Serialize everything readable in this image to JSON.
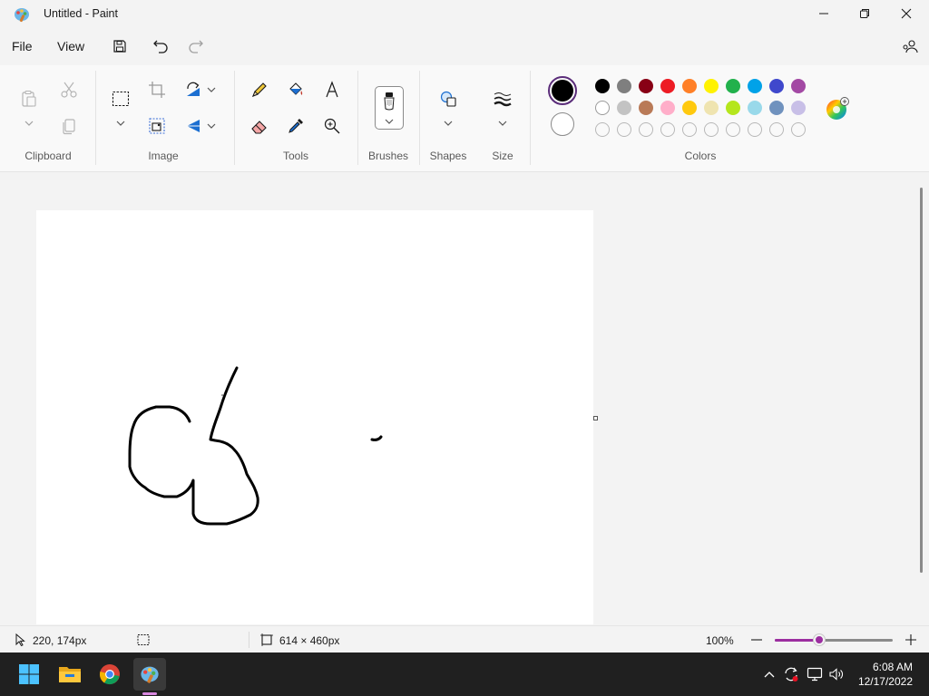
{
  "window": {
    "title": "Untitled - Paint",
    "controls": [
      "minimize-icon",
      "restore-icon",
      "close-icon"
    ]
  },
  "menu": {
    "file": "File",
    "view": "View",
    "icons": [
      "save-icon",
      "undo-icon",
      "redo-icon",
      "share-icon"
    ]
  },
  "ribbon": {
    "groups": {
      "clipboard": "Clipboard",
      "image": "Image",
      "tools": "Tools",
      "brushes": "Brushes",
      "shapes": "Shapes",
      "size": "Size",
      "colors": "Colors"
    },
    "primary_color": "#000000",
    "secondary_color": "#ffffff",
    "palette_row1": [
      "#000000",
      "#7f7f7f",
      "#880015",
      "#ed1c24",
      "#ff7f27",
      "#fff200",
      "#22b14c",
      "#00a2e8",
      "#3f48cc",
      "#a349a4"
    ],
    "palette_row2": [
      "#ffffff",
      "#c3c3c3",
      "#b97a57",
      "#ffaec9",
      "#ffc90e",
      "#efe4b0",
      "#b5e61d",
      "#99d9ea",
      "#7092be",
      "#c8bfe7"
    ],
    "palette_row3_empty_count": 10
  },
  "status": {
    "cursor_position": "220, 174px",
    "canvas_size": "614 × 460px",
    "zoom": "100%",
    "zoom_fraction": 0.38
  },
  "taskbar": {
    "apps": [
      "start-icon",
      "file-explorer-icon",
      "chrome-icon",
      "paint-icon"
    ],
    "time": "6:08 AM",
    "date": "12/17/2022"
  },
  "accent_color": "#9c2ea0"
}
